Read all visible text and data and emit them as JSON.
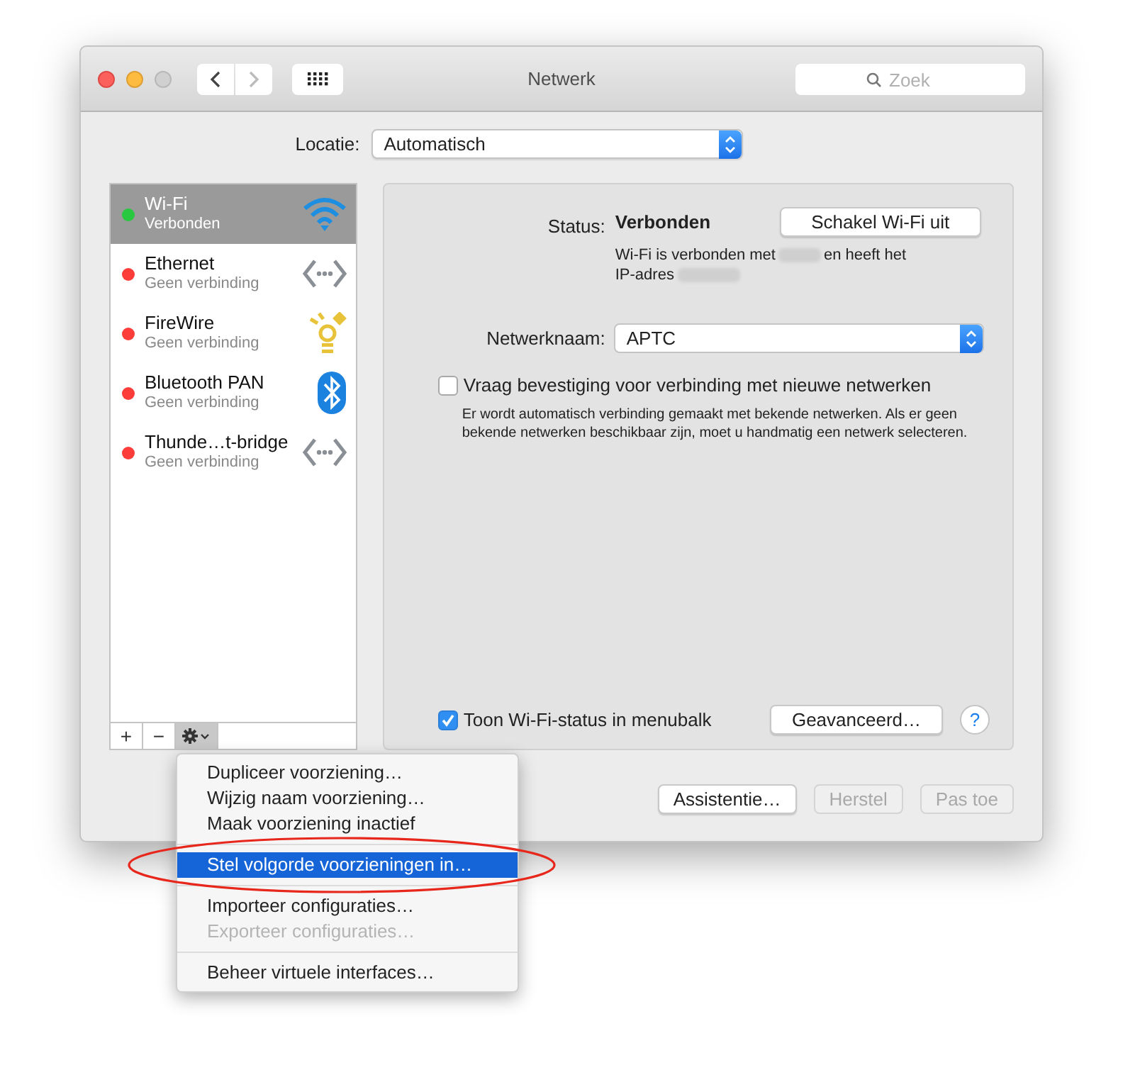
{
  "window": {
    "title": "Netwerk"
  },
  "search": {
    "placeholder": "Zoek"
  },
  "location": {
    "label": "Locatie:",
    "value": "Automatisch"
  },
  "services": [
    {
      "name": "Wi-Fi",
      "status": "Verbonden",
      "color": "#28c840",
      "kind": "wifi",
      "selected": true
    },
    {
      "name": "Ethernet",
      "status": "Geen verbinding",
      "color": "#fc3d39",
      "kind": "ethernet",
      "selected": false
    },
    {
      "name": "FireWire",
      "status": "Geen verbinding",
      "color": "#fc3d39",
      "kind": "firewire",
      "selected": false
    },
    {
      "name": "Bluetooth PAN",
      "status": "Geen verbinding",
      "color": "#fc3d39",
      "kind": "bluetooth",
      "selected": false
    },
    {
      "name": "Thunde…t-bridge",
      "status": "Geen verbinding",
      "color": "#fc3d39",
      "kind": "ethernet",
      "selected": false
    }
  ],
  "list_buttons": [
    "+",
    "−"
  ],
  "detail": {
    "status_label": "Status:",
    "status_value": "Verbonden",
    "toggle_button": "Schakel Wi-Fi uit",
    "info_1": "Wi-Fi is verbonden met",
    "info_2": "en heeft het",
    "info_3": "IP-adres",
    "network_label": "Netwerknaam:",
    "network_value": "APTC",
    "ask_checkbox": {
      "label": "Vraag bevestiging voor verbinding met nieuwe netwerken",
      "checked": false
    },
    "ask_help": "Er wordt automatisch verbinding gemaakt met bekende netwerken. Als er geen bekende netwerken beschikbaar zijn, moet u handmatig een netwerk selecteren.",
    "menubar_checkbox": {
      "label": "Toon Wi-Fi-status in menubalk",
      "checked": true
    },
    "advanced_button": "Geavanceerd…",
    "help_button": "?"
  },
  "footer_buttons": [
    {
      "label": "Assistentie…",
      "disabled": false
    },
    {
      "label": "Herstel",
      "disabled": true
    },
    {
      "label": "Pas toe",
      "disabled": true
    }
  ],
  "menu": {
    "groups": [
      [
        {
          "label": "Dupliceer voorziening…",
          "selected": false,
          "disabled": false
        },
        {
          "label": "Wijzig naam voorziening…",
          "selected": false,
          "disabled": false
        },
        {
          "label": "Maak voorziening inactief",
          "selected": false,
          "disabled": false
        }
      ],
      [
        {
          "label": "Stel volgorde voorzieningen in…",
          "selected": true,
          "disabled": false
        }
      ],
      [
        {
          "label": "Importeer configuraties…",
          "selected": false,
          "disabled": false
        },
        {
          "label": "Exporteer configuraties…",
          "selected": false,
          "disabled": true
        }
      ],
      [
        {
          "label": "Beheer virtuele interfaces…",
          "selected": false,
          "disabled": false
        }
      ]
    ]
  }
}
